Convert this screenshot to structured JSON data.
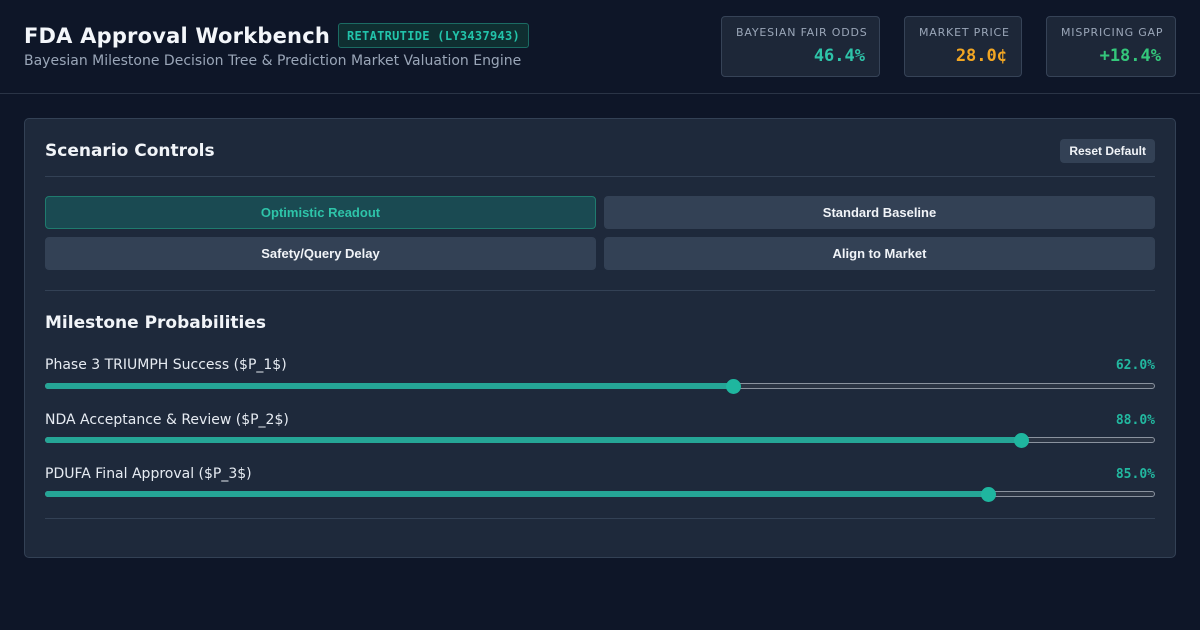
{
  "header": {
    "title": "FDA Approval Workbench",
    "badge": "RETATRUTIDE (LY3437943)",
    "subtitle": "Bayesian Milestone Decision Tree & Prediction Market Valuation Engine"
  },
  "metrics": [
    {
      "label": "BAYESIAN FAIR ODDS",
      "value": "46.4%",
      "color": "#2ec4a9"
    },
    {
      "label": "MARKET PRICE",
      "value": "28.0¢",
      "color": "#f2a623"
    },
    {
      "label": "MISPRICING GAP",
      "value": "+18.4%",
      "color": "#34c77b"
    }
  ],
  "controls": {
    "title": "Scenario Controls",
    "reset_label": "Reset Default",
    "scenarios": [
      {
        "label": "Optimistic Readout",
        "active": true
      },
      {
        "label": "Standard Baseline",
        "active": false
      },
      {
        "label": "Safety/Query Delay",
        "active": false
      },
      {
        "label": "Align to Market",
        "active": false
      }
    ]
  },
  "milestones": {
    "title": "Milestone Probabilities",
    "items": [
      {
        "label": "Phase 3 TRIUMPH Success ($P_1$)",
        "value_text": "62.0%",
        "value": 0.62
      },
      {
        "label": "NDA Acceptance & Review ($P_2$)",
        "value_text": "88.0%",
        "value": 0.88
      },
      {
        "label": "PDUFA Final Approval ($P_3$)",
        "value_text": "85.0%",
        "value": 0.85
      }
    ]
  }
}
